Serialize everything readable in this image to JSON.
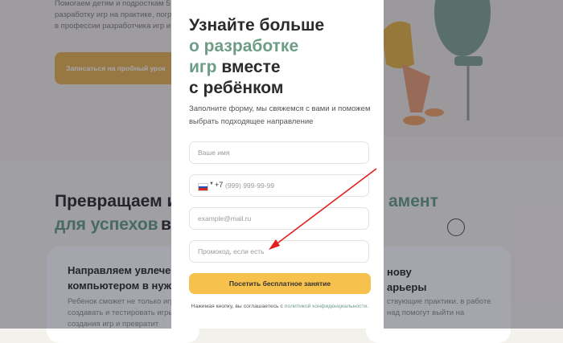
{
  "background": {
    "intro_lines": [
      "Помогаем детям и подросткам 5",
      "разработку игр на практике, погр",
      "в профессии разработчика игр и"
    ],
    "trial_button": "Записаться на пробный урок",
    "heading_left_1": "Превращаем и",
    "heading_right_1": "амент",
    "heading_left_2": "для успехов",
    "heading_left_2b": "в",
    "card_left": {
      "title": "Направляем увлечен компьютером в нужн",
      "text": "Ребенок сможет не только игр создавать и тестировать игры для создания игр и превратит"
    },
    "card_right": {
      "title": "нову арьеры",
      "text": "ствующие практики. в работе над помогут выйти на"
    }
  },
  "modal": {
    "title_line1": "Узнайте больше",
    "title_accent": "о разработке игр",
    "title_accent_a": "о разработке",
    "title_accent_b": "игр",
    "title_rest_b": " вместе",
    "title_line4": "с ребёнком",
    "description": "Заполните форму, мы свяжемся с вами и поможем выбрать подходящее направление",
    "name_placeholder": "Ваше имя",
    "phone_code": "+7",
    "phone_placeholder": "(999) 999-99-99",
    "email_placeholder": "example@mail.ru",
    "promo_placeholder": "Промокод, если есть",
    "submit_label": "Посетить бесплатное занятие",
    "consent_text": "Нажимая кнопку, вы соглашаетесь с",
    "consent_link": "политикой конфиденциальности."
  },
  "colors": {
    "accent": "#6d9d86",
    "button": "#f7c14e",
    "arrow": "#e02020"
  },
  "icons": {
    "flag": "russia-flag-icon",
    "caret": "chevron-down-icon",
    "arrow": "red-arrow-annotation"
  }
}
